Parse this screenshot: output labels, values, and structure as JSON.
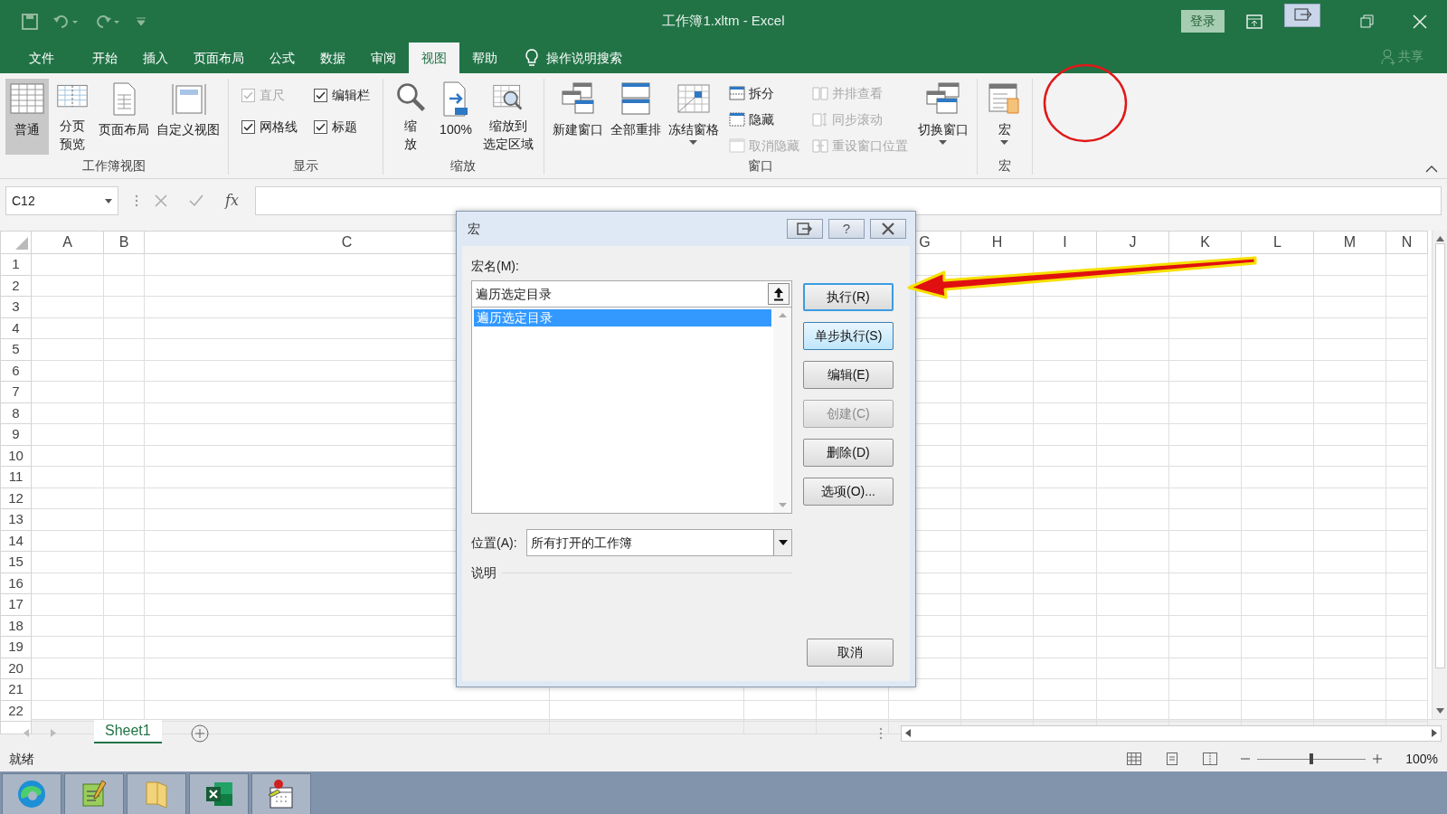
{
  "window": {
    "title": "工作簿1.xltm  -  Excel",
    "sign_in": "登录",
    "share": "共享"
  },
  "tabs": [
    {
      "label": "文件",
      "selected": false
    },
    {
      "label": "开始",
      "selected": false
    },
    {
      "label": "插入",
      "selected": false
    },
    {
      "label": "页面布局",
      "selected": false
    },
    {
      "label": "公式",
      "selected": false
    },
    {
      "label": "数据",
      "selected": false
    },
    {
      "label": "审阅",
      "selected": false
    },
    {
      "label": "视图",
      "selected": true
    },
    {
      "label": "帮助",
      "selected": false
    }
  ],
  "tell_me": "操作说明搜索",
  "ribbon": {
    "groups": [
      {
        "title": "工作簿视图",
        "items": [
          {
            "kind": "large",
            "label": "普通",
            "selected": true,
            "dropdown": false
          },
          {
            "kind": "large",
            "label": "分页预览",
            "selected": false,
            "dropdown": false
          },
          {
            "kind": "large",
            "label": "页面布局",
            "selected": false,
            "dropdown": false
          },
          {
            "kind": "large",
            "label": "自定义视图",
            "selected": false,
            "dropdown": false
          }
        ]
      },
      {
        "title": "显示",
        "items": [
          {
            "kind": "check",
            "label": "直尺",
            "checked": true,
            "disabled": true
          },
          {
            "kind": "check",
            "label": "编辑栏",
            "checked": true,
            "disabled": false
          },
          {
            "kind": "check",
            "label": "网格线",
            "checked": true,
            "disabled": false
          },
          {
            "kind": "check",
            "label": "标题",
            "checked": true,
            "disabled": false
          }
        ]
      },
      {
        "title": "缩放",
        "items": [
          {
            "kind": "large",
            "label": "缩放",
            "selected": false,
            "dropdown": false
          },
          {
            "kind": "large",
            "label": "100%",
            "selected": false,
            "dropdown": false
          },
          {
            "kind": "large",
            "label": "缩放到选定区域",
            "selected": false,
            "dropdown": false
          }
        ]
      },
      {
        "title": "窗口",
        "items": [
          {
            "kind": "large",
            "label": "新建窗口",
            "selected": false,
            "dropdown": false
          },
          {
            "kind": "large",
            "label": "全部重排",
            "selected": false,
            "dropdown": false
          },
          {
            "kind": "large",
            "label": "冻结窗格",
            "selected": false,
            "dropdown": true
          },
          {
            "kind": "small",
            "label": "拆分",
            "disabled": false
          },
          {
            "kind": "small",
            "label": "隐藏",
            "disabled": false
          },
          {
            "kind": "small",
            "label": "取消隐藏",
            "disabled": true
          },
          {
            "kind": "small",
            "label": "并排查看",
            "disabled": true
          },
          {
            "kind": "small",
            "label": "同步滚动",
            "disabled": true
          },
          {
            "kind": "small",
            "label": "重设窗口位置",
            "disabled": true
          },
          {
            "kind": "large",
            "label": "切换窗口",
            "selected": false,
            "dropdown": true
          }
        ]
      },
      {
        "title": "宏",
        "items": [
          {
            "kind": "large",
            "label": "宏",
            "selected": false,
            "dropdown": true
          }
        ]
      }
    ]
  },
  "formula_bar": {
    "name_box": "C12",
    "fx": "fx"
  },
  "sheet": {
    "column_headers": [
      "A",
      "B",
      "C",
      "G",
      "H",
      "I",
      "J",
      "K",
      "L",
      "M",
      "N"
    ],
    "row_numbers": [
      "1",
      "2",
      "3",
      "4",
      "5",
      "6",
      "7",
      "8",
      "9",
      "10",
      "11",
      "12",
      "13",
      "14",
      "15",
      "16",
      "17",
      "18",
      "19",
      "20",
      "21",
      "22"
    ]
  },
  "sheet_tabs": [
    {
      "label": "Sheet1",
      "selected": true
    }
  ],
  "status_bar": {
    "text": "就绪",
    "zoom": "100%",
    "zoom_slider": {
      "level": 0.5
    }
  },
  "dialog": {
    "title": "宏",
    "help": "?",
    "name_label": "宏名(M):",
    "name_value": "遍历选定目录",
    "macros": [
      {
        "label": "遍历选定目录",
        "selected": true
      }
    ],
    "location_label": "位置(A):",
    "location_value": "所有打开的工作簿",
    "description_label": "说明",
    "buttons": [
      {
        "label": "执行(R)",
        "default": true,
        "hovered": false,
        "disabled": false
      },
      {
        "label": "单步执行(S)",
        "default": false,
        "hovered": true,
        "disabled": false
      },
      {
        "label": "编辑(E)",
        "default": false,
        "hovered": false,
        "disabled": false
      },
      {
        "label": "创建(C)",
        "default": false,
        "hovered": false,
        "disabled": true
      },
      {
        "label": "删除(D)",
        "default": false,
        "hovered": false,
        "disabled": false
      },
      {
        "label": "选项(O)...",
        "default": false,
        "hovered": false,
        "disabled": false
      }
    ],
    "cancel": "取消"
  }
}
